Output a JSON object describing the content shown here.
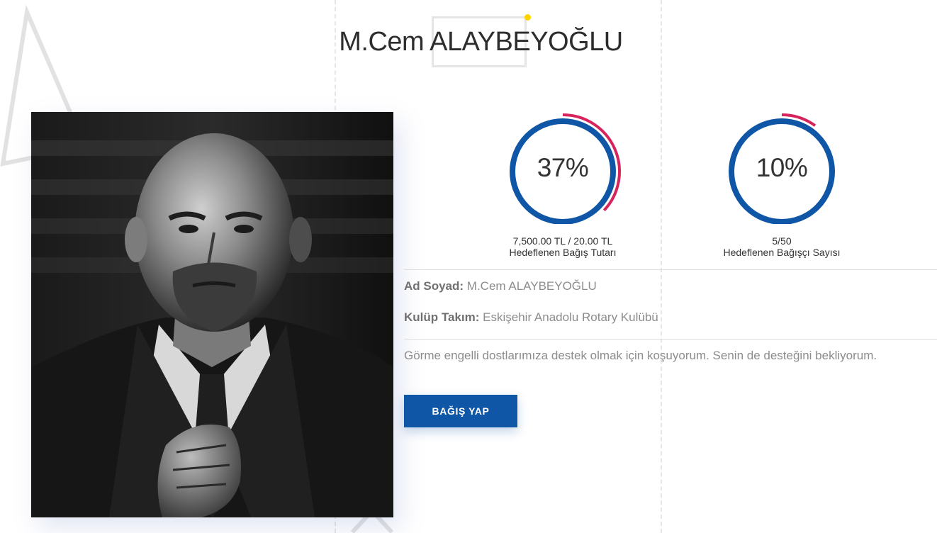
{
  "page": {
    "title": "M.Cem ALAYBEYOĞLU"
  },
  "photo": {
    "alt_subject": "portrait-photo"
  },
  "stats": [
    {
      "percent_text": "37%",
      "progress": 0.37,
      "amount_text": "7,500.00 TL / 20.00 TL",
      "label": "Hedeflenen Bağış Tutarı"
    },
    {
      "percent_text": "10%",
      "progress": 0.1,
      "amount_text": "5/50",
      "label": "Hedeflenen Bağışçı Sayısı"
    }
  ],
  "info": {
    "name_label": "Ad Soyad:",
    "name_value": "M.Cem ALAYBEYOĞLU",
    "club_label": "Kulüp Takım:",
    "club_value": "Eskişehir Anadolu Rotary Kulübü"
  },
  "description": "Görme engelli dostlarımıza destek olmak için koşuyorum. Senin de desteğini bekliyorum.",
  "donate_button": {
    "label": "BAĞIŞ YAP"
  },
  "colors": {
    "ring_blue": "#0f56a6",
    "ring_red": "#d6245d",
    "accent_yellow": "#ffd400",
    "button_blue": "#0f56a6"
  }
}
